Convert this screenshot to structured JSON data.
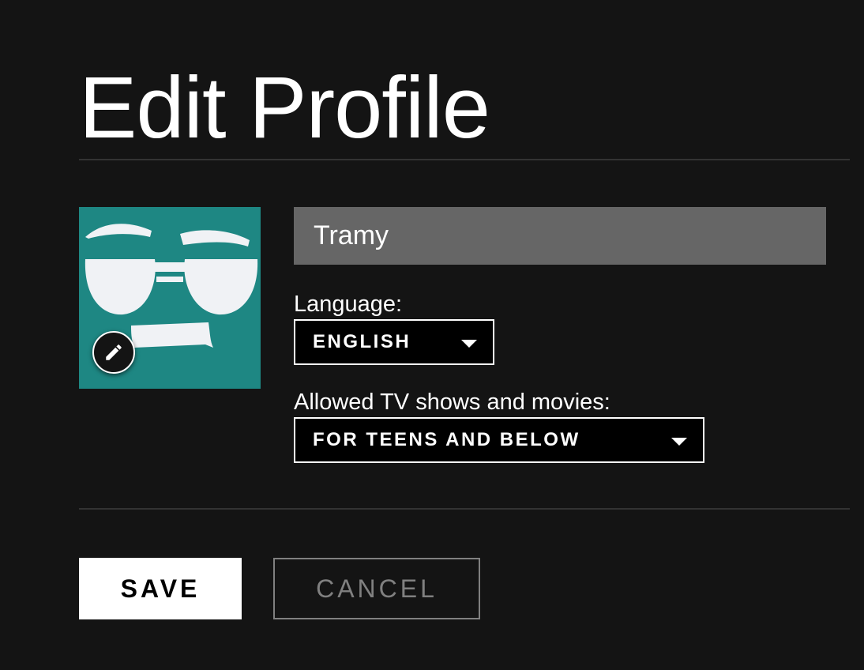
{
  "header": {
    "title": "Edit Profile"
  },
  "profile": {
    "avatar": {
      "icon": "sunglasses-face-avatar",
      "background_color": "#1e8783",
      "edit_icon": "pencil-icon"
    },
    "name_value": "Tramy"
  },
  "language": {
    "label": "Language:",
    "selected": "ENGLISH",
    "icon": "caret-down-icon"
  },
  "maturity": {
    "label": "Allowed TV shows and movies:",
    "selected": "FOR TEENS AND BELOW",
    "icon": "caret-down-icon"
  },
  "actions": {
    "save_label": "SAVE",
    "cancel_label": "CANCEL"
  },
  "colors": {
    "background": "#141414",
    "input_background": "#666666",
    "divider": "#333333",
    "cancel_text": "#808080"
  }
}
